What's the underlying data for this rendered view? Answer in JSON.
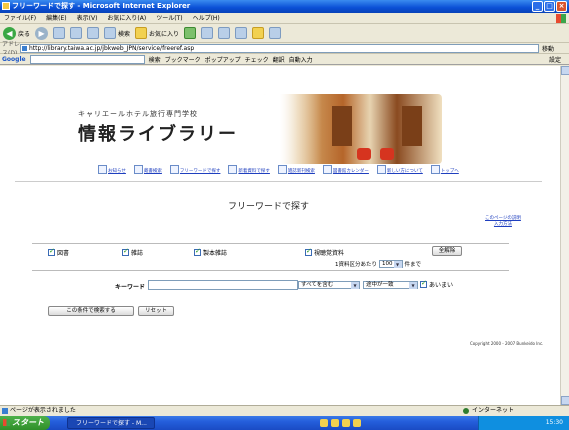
{
  "window": {
    "title": "フリーワードで探す - Microsoft Internet Explorer"
  },
  "menu": [
    "ファイル(F)",
    "編集(E)",
    "表示(V)",
    "お気に入り(A)",
    "ツール(T)",
    "ヘルプ(H)"
  ],
  "toolbar": {
    "back": "戻る",
    "search": "検索",
    "favorites": "お気に入り"
  },
  "address": {
    "label": "アドレス(D)",
    "url": "http://library.taiwa.ac.jp/jbkweb_JPN/service/freeref.asp",
    "go": "移動"
  },
  "google": {
    "logo": "Google",
    "search": "検索",
    "bookmarks": "ブックマーク",
    "popups": "ポップアップ",
    "check": "チェック",
    "translate": "翻訳",
    "autofill": "自動入力",
    "settings": "設定"
  },
  "header": {
    "school_name": "キャリエールホテル旅行専門学校",
    "library_title": "情報ライブラリー"
  },
  "nav": [
    "お知らせ",
    "蔵書検索",
    "フリーワードで探す",
    "新着資料で探す",
    "雑誌新刊検索",
    "図書館カレンダー",
    "新しい方について",
    "トップへ"
  ],
  "main": {
    "heading": "フリーワードで探す",
    "help_link": "このページの説明\n入力方法",
    "checkboxes": [
      "図書",
      "雑誌",
      "製本雑誌",
      "視聴覚資料"
    ],
    "clear_all": "全解除",
    "per_page_label": "1資料区分あたり",
    "per_page_value": "100",
    "per_page_suffix": "件まで",
    "keyword_label": "キーワード",
    "keyword_value": "",
    "match_option": "すべてを含む",
    "position_option": "途中が一致",
    "fuzzy_label": "あいまい",
    "search_button": "この条件で検索する",
    "reset_button": "リセット",
    "copyright": "Copyright 2000 - 2007 Bunkeido Inc."
  },
  "status": {
    "text": "ページが表示されました",
    "zone": "インターネット"
  },
  "taskbar": {
    "start": "スタート",
    "task": "フリーワードで探す - M...",
    "time": "15:30"
  }
}
